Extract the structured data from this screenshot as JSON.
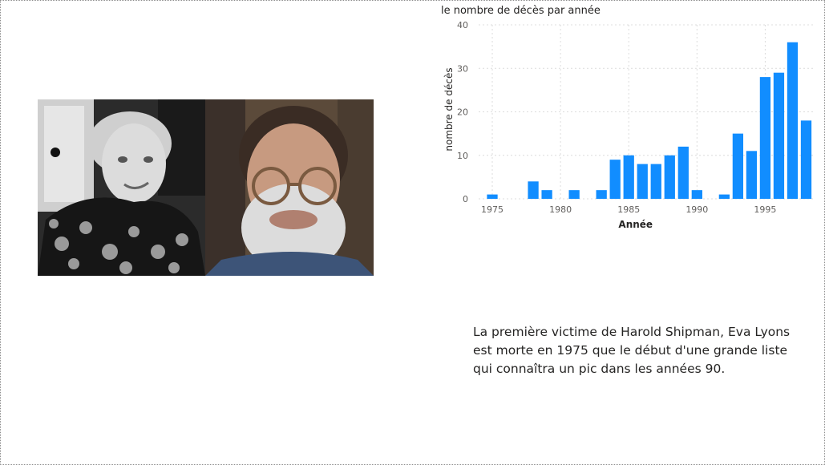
{
  "chart_data": {
    "type": "bar",
    "title": "le nombre de décès par année",
    "xlabel": "Année",
    "ylabel": "nombre de décès",
    "x": [
      1975,
      1978,
      1979,
      1981,
      1983,
      1984,
      1985,
      1986,
      1987,
      1988,
      1989,
      1990,
      1992,
      1993,
      1994,
      1995,
      1996,
      1997,
      1998
    ],
    "values": [
      1,
      4,
      2,
      2,
      2,
      9,
      10,
      8,
      8,
      10,
      12,
      2,
      1,
      15,
      11,
      28,
      29,
      36,
      18
    ],
    "xticks": [
      "1975",
      "1980",
      "1985",
      "1990",
      "1995"
    ],
    "yticks": [
      "0",
      "10",
      "20",
      "30",
      "40"
    ],
    "ylim": [
      0,
      40
    ],
    "grid": true,
    "bar_color": "#118DFF"
  },
  "caption": {
    "lines": [
      "La première victime de Harold Shipman, Eva Lyons",
      "est morte en 1975 que le début d'une grande liste",
      "qui connaîtra un pic dans les années 90."
    ]
  }
}
